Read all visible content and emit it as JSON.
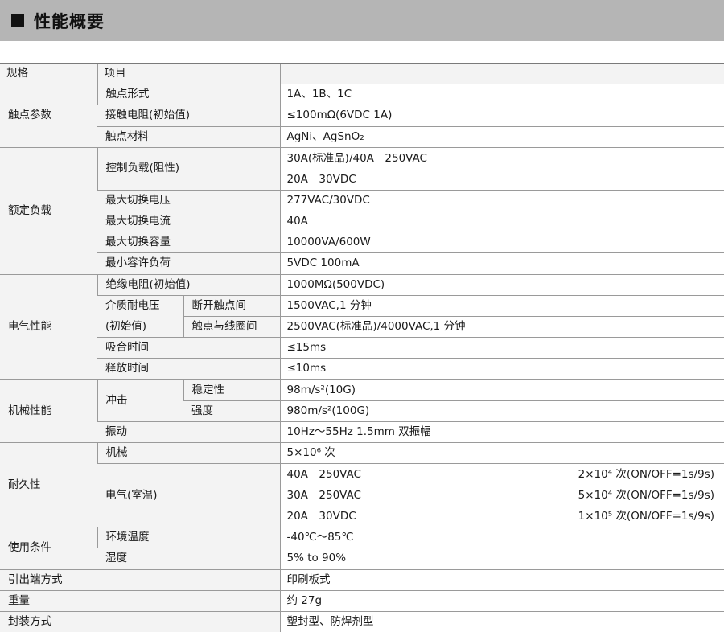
{
  "header": {
    "title": "性能概要"
  },
  "table": {
    "col_spec": "规格",
    "col_item": "项目",
    "contact": {
      "label": "触点参数",
      "form_label": "触点形式",
      "form_value": "1A、1B、1C",
      "resistance_label": "接触电阻(初始值)",
      "resistance_value": "≤100mΩ(6VDC 1A)",
      "material_label": "触点材料",
      "material_value": "AgNi、AgSnO₂"
    },
    "rated_load": {
      "label": "额定负载",
      "control_label": "控制负载(阻性)",
      "control_value_1": "30A(标准品)/40A　250VAC",
      "control_value_2": "20A　30VDC",
      "max_voltage_label": "最大切换电压",
      "max_voltage_value": "277VAC/30VDC",
      "max_current_label": "最大切换电流",
      "max_current_value": "40A",
      "max_capacity_label": "最大切换容量",
      "max_capacity_value": "10000VA/600W",
      "min_load_label": "最小容许负荷",
      "min_load_value": "5VDC 100mA"
    },
    "electrical": {
      "label": "电气性能",
      "insulation_label": "绝缘电阻(初始值)",
      "insulation_value": "1000MΩ(500VDC)",
      "dielectric_label_1": "介质耐电压",
      "dielectric_label_2": "(初始值)",
      "open_contacts_label": "断开触点间",
      "open_contacts_value": "1500VAC,1 分钟",
      "contact_coil_label": "触点与线圈间",
      "contact_coil_value": "2500VAC(标准品)/4000VAC,1 分钟",
      "operate_time_label": "吸合时间",
      "operate_time_value": "≤15ms",
      "release_time_label": "释放时间",
      "release_time_value": "≤10ms"
    },
    "mechanical": {
      "label": "机械性能",
      "shock_label": "冲击",
      "stability_label": "稳定性",
      "stability_value": "98m/s²(10G)",
      "strength_label": "强度",
      "strength_value": "980m/s²(100G)",
      "vibration_label": "振动",
      "vibration_value": "10Hz～55Hz 1.5mm  双振幅"
    },
    "endurance": {
      "label": "耐久性",
      "mechanical_label": "机械",
      "mechanical_value": "5×10⁶ 次",
      "electrical_label": "电气(室温)",
      "elec_rows": [
        {
          "load": "40A　250VAC",
          "life": "2×10⁴ 次(ON/OFF=1s/9s)"
        },
        {
          "load": "30A　250VAC",
          "life": "5×10⁴ 次(ON/OFF=1s/9s)"
        },
        {
          "load": "20A　30VDC",
          "life": "1×10⁵ 次(ON/OFF=1s/9s)"
        }
      ]
    },
    "conditions": {
      "label": "使用条件",
      "temp_label": "环境温度",
      "temp_value": "-40℃～85℃",
      "humidity_label": "湿度",
      "humidity_value": "5% to 90%"
    },
    "terminal_label": "引出端方式",
    "terminal_value": "印刷板式",
    "weight_label": "重量",
    "weight_value": "约 27g",
    "package_label": "封装方式",
    "package_value": "塑封型、防焊剂型"
  }
}
